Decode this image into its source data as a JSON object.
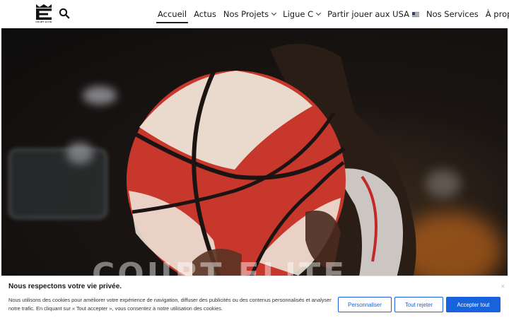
{
  "header": {
    "logo_alt": "COURT ELITE",
    "logo_caption": "COURT ELITE",
    "search_icon": "search-icon",
    "nav": [
      {
        "label": "Accueil",
        "active": true,
        "dropdown": false
      },
      {
        "label": "Actus",
        "active": false,
        "dropdown": false
      },
      {
        "label": "Nos Projets",
        "active": false,
        "dropdown": true
      },
      {
        "label": "Ligue C",
        "active": false,
        "dropdown": true
      },
      {
        "label": "Partir jouer aux USA",
        "active": false,
        "dropdown": false,
        "flag": "us-flag-icon"
      },
      {
        "label": "Nos Services",
        "active": false,
        "dropdown": false
      },
      {
        "label": "À propos",
        "active": false,
        "dropdown": true
      }
    ]
  },
  "hero": {
    "image": "basketball-player-holding-ball",
    "wordmark": "COURT ELITE"
  },
  "cookie": {
    "title": "Nous respectons votre vie privée.",
    "text": "Nous utilisons des cookies pour améliorer votre expérience de navigation, diffuser des publicités ou des contenus personnalisés et analyser notre trafic. En cliquant sur « Tout accepter », vous consentez à notre utilisation des cookies.",
    "close_label": "×",
    "customize_label": "Personnaliser",
    "reject_label": "Tout rejeter",
    "accept_label": "Accepter tout",
    "accent_color": "#1863dc"
  }
}
